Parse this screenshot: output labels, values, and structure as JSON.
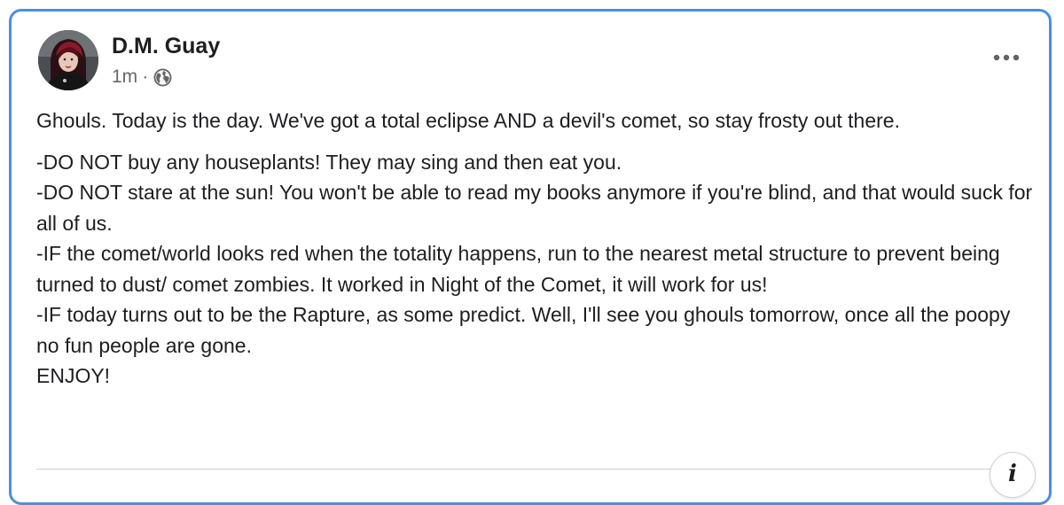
{
  "post": {
    "author": "D.M. Guay",
    "timestamp": "1m",
    "separator": "·",
    "privacy_icon": "globe-icon",
    "more_icon": "more-options-icon",
    "info_icon": "info-icon",
    "info_glyph": "i",
    "paragraphs": [
      "Ghouls. Today is the day. We've got a total eclipse AND a devil's comet, so stay frosty out there.",
      "-DO NOT buy any houseplants! They may sing and then eat you.",
      "-DO NOT stare at the sun! You won't be able to read my books anymore if you're blind, and that would suck for all of us.",
      "-IF the comet/world looks red when the totality happens, run to the nearest metal structure to prevent being turned to dust/ comet zombies. It worked in Night of the Comet, it will work for us!",
      "-IF today turns out to be the Rapture, as some predict. Well, I'll see you ghouls tomorrow, once all the poopy no fun people are gone.",
      "ENJOY!"
    ]
  },
  "colors": {
    "card_border": "#4a8fe0",
    "text_primary": "#1c1e21",
    "text_secondary": "#65676b"
  }
}
